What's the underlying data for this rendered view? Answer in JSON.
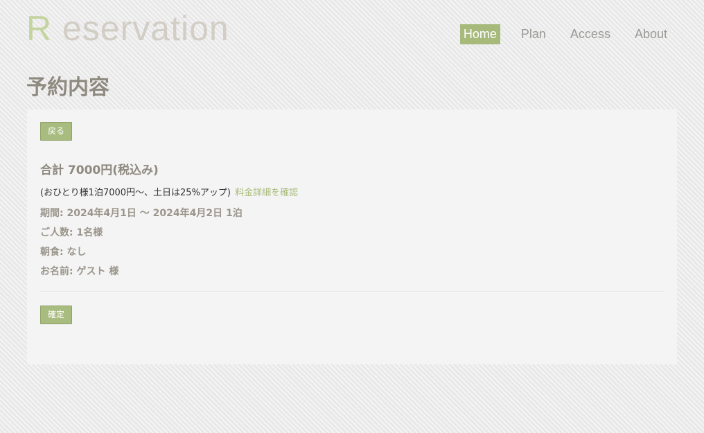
{
  "header": {
    "logo_initial": "R",
    "logo_rest": " eservation",
    "nav": [
      {
        "label": "Home",
        "active": true
      },
      {
        "label": "Plan",
        "active": false
      },
      {
        "label": "Access",
        "active": false
      },
      {
        "label": "About",
        "active": false
      }
    ]
  },
  "page": {
    "title": "予約内容"
  },
  "reservation": {
    "back_label": "戻る",
    "total": "合計 7000円(税込み)",
    "price_note": "(おひとり様1泊7000円～、土日は25%アップ)",
    "price_detail_link": "料金詳細を確認",
    "period": "期間: 2024年4月1日 〜 2024年4月2日 1泊",
    "people": "ご人数: 1名様",
    "breakfast": "朝食: なし",
    "name": "お名前: ゲスト 様",
    "confirm_label": "確定"
  },
  "colors": {
    "accent": "#a9bc7f",
    "title": "#8f8a80",
    "link": "#a6ba77"
  }
}
